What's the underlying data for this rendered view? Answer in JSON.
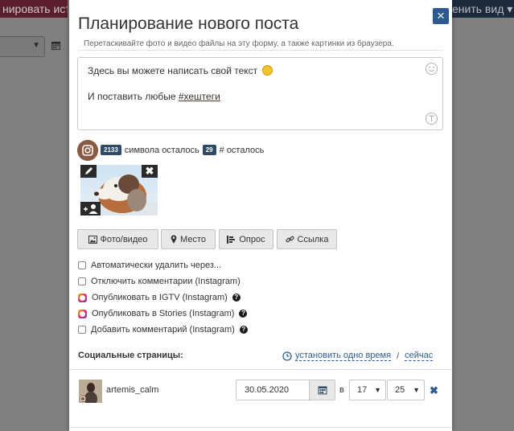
{
  "background": {
    "left_tab": "нировать ист",
    "right_tab": "енить вид ▾"
  },
  "modal": {
    "title": "Планирование нового поста",
    "close_icon": "×",
    "hint": "Перетаскивайте фото и видео файлы на эту форму, а также картинки из браузера."
  },
  "editor": {
    "line1": "Здесь вы можете написать свой текст",
    "line2_prefix": "И поставить любые ",
    "line2_hashtag": "#хештеги"
  },
  "counter": {
    "chars": "2133",
    "chars_label": "символа осталось",
    "tags": "29",
    "tags_label": "# осталось"
  },
  "media_buttons": {
    "photo": "Фото/видео",
    "place": "Место",
    "poll": "Опрос",
    "link": "Ссылка"
  },
  "options": [
    {
      "label": "Автоматически удалить через...",
      "kind": "checkbox",
      "help": false
    },
    {
      "label": "Отключить комментарии (Instagram)",
      "kind": "checkbox",
      "help": false
    },
    {
      "label": "Опубликовать в IGTV (Instagram)",
      "kind": "instagram",
      "help": true
    },
    {
      "label": "Опубликовать в Stories (Instagram)",
      "kind": "instagram",
      "help": true
    },
    {
      "label": "Добавить комментарий (Instagram)",
      "kind": "checkbox",
      "help": true
    }
  ],
  "social": {
    "title": "Социальные страницы:",
    "set_one_time": "установить одно время",
    "separator": "/",
    "now": "сейчас"
  },
  "account": {
    "name": "artemis_calm",
    "date": "30.05.2020",
    "at_label": "в",
    "hour": "17",
    "minute": "25",
    "remove_icon": "✖"
  },
  "colors": {
    "accent": "#2e5b8e",
    "badge": "#2e4a66",
    "button_bg": "#e8e8e8"
  }
}
